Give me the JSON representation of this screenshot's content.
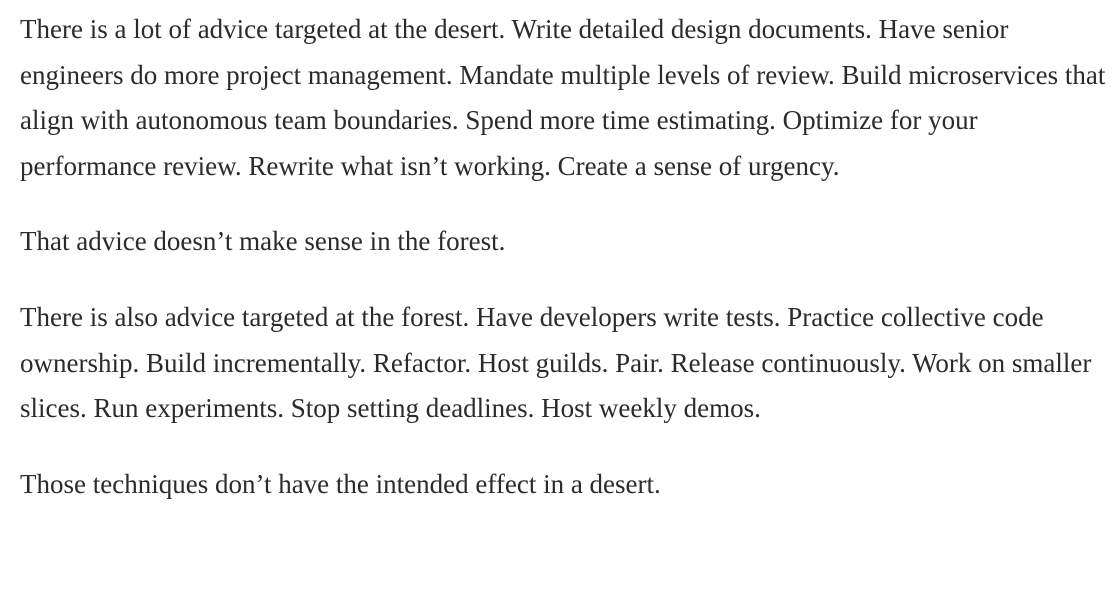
{
  "article": {
    "paragraphs": [
      "There is a lot of advice targeted at the desert. Write detailed design documents. Have senior engineers do more project management. Mandate multiple levels of review. Build microservices that align with autonomous team boundaries. Spend more time estimating. Optimize for your performance review. Rewrite what isn’t working. Create a sense of urgency.",
      "That advice doesn’t make sense in the forest.",
      "There is also advice targeted at the forest. Have developers write tests. Practice collective code ownership. Build incrementally. Refactor. Host guilds. Pair. Release continuously. Work on smaller slices. Run experiments. Stop setting deadlines. Host weekly demos.",
      "Those techniques don’t have the intended effect in a desert."
    ]
  }
}
